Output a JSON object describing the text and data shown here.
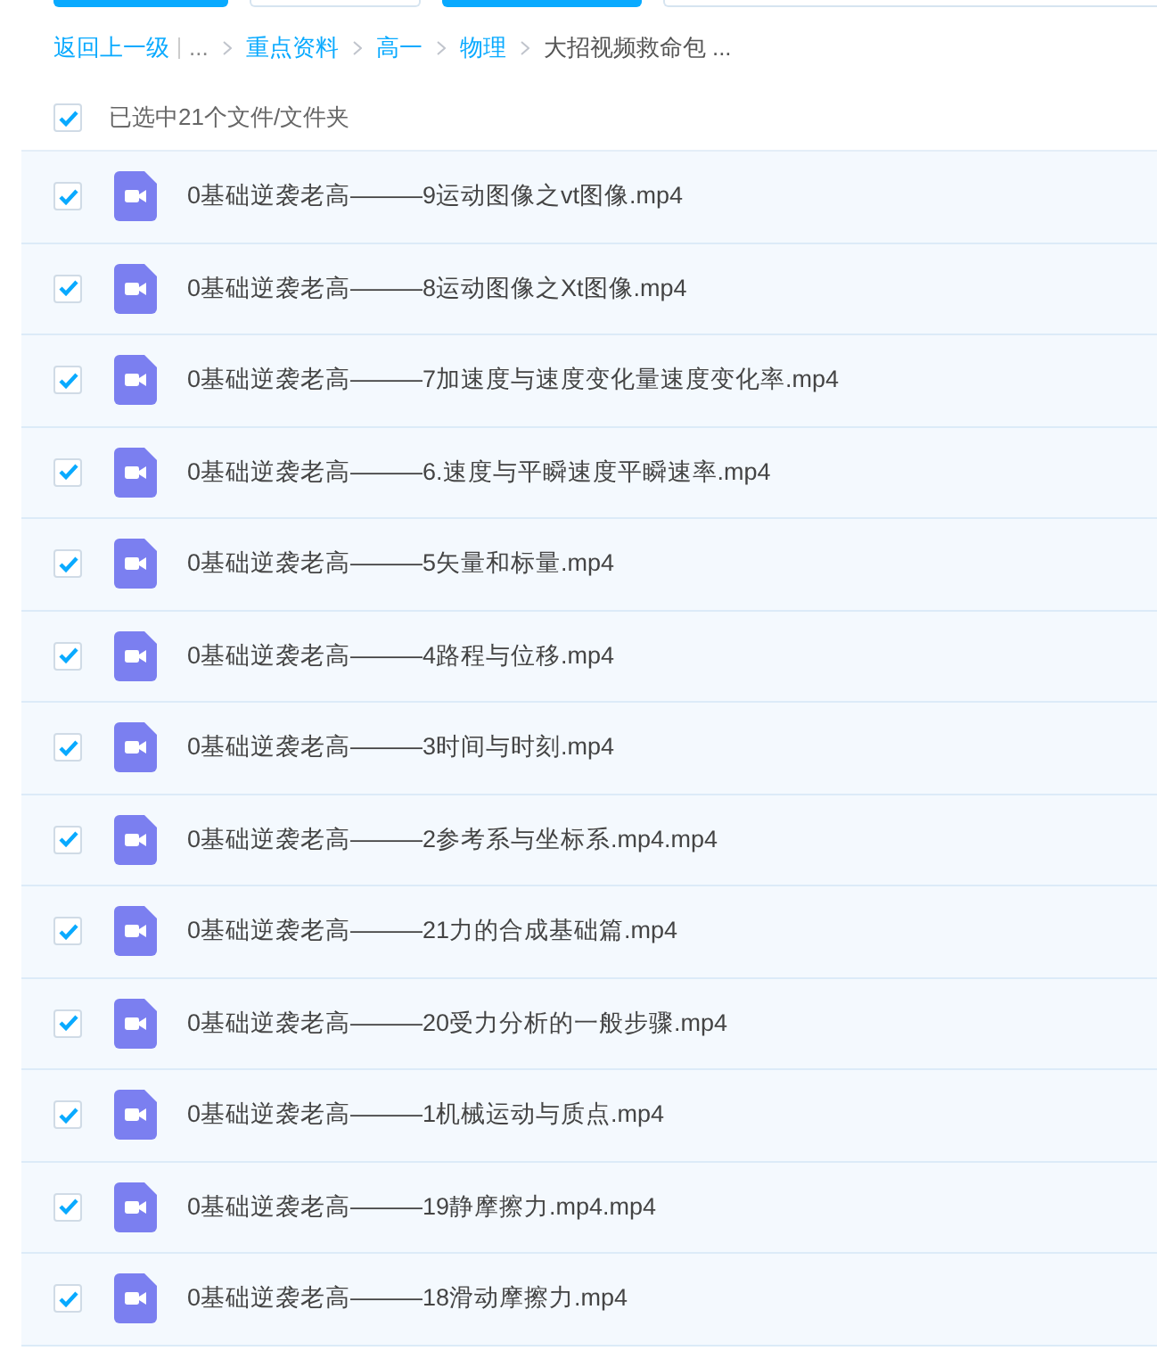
{
  "breadcrumb": [
    {
      "label": "返回上一级",
      "kind": "link"
    },
    {
      "label": "...",
      "kind": "text"
    },
    {
      "label": "重点资料",
      "kind": "link"
    },
    {
      "label": "高一",
      "kind": "link"
    },
    {
      "label": "物理",
      "kind": "link"
    },
    {
      "label": "大招视频救命包 ...",
      "kind": "current"
    }
  ],
  "select_all": {
    "label": "已选中21个文件/文件夹",
    "checked": true
  },
  "files": [
    {
      "name": "0基础逆袭老高———9运动图像之vt图像.mp4",
      "selected": true
    },
    {
      "name": "0基础逆袭老高———8运动图像之Xt图像.mp4",
      "selected": true
    },
    {
      "name": "0基础逆袭老高———7加速度与速度变化量速度变化率.mp4",
      "selected": true
    },
    {
      "name": "0基础逆袭老高———6.速度与平瞬速度平瞬速率.mp4",
      "selected": true
    },
    {
      "name": "0基础逆袭老高———5矢量和标量.mp4",
      "selected": true
    },
    {
      "name": "0基础逆袭老高———4路程与位移.mp4",
      "selected": true
    },
    {
      "name": "0基础逆袭老高———3时间与时刻.mp4",
      "selected": true
    },
    {
      "name": "0基础逆袭老高———2参考系与坐标系.mp4.mp4",
      "selected": true
    },
    {
      "name": "0基础逆袭老高———21力的合成基础篇.mp4",
      "selected": true
    },
    {
      "name": "0基础逆袭老高———20受力分析的一般步骤.mp4",
      "selected": true
    },
    {
      "name": "0基础逆袭老高———1机械运动与质点.mp4",
      "selected": true
    },
    {
      "name": "0基础逆袭老高———19静摩擦力.mp4.mp4",
      "selected": true
    },
    {
      "name": "0基础逆袭老高———18滑动摩擦力.mp4",
      "selected": true
    }
  ]
}
